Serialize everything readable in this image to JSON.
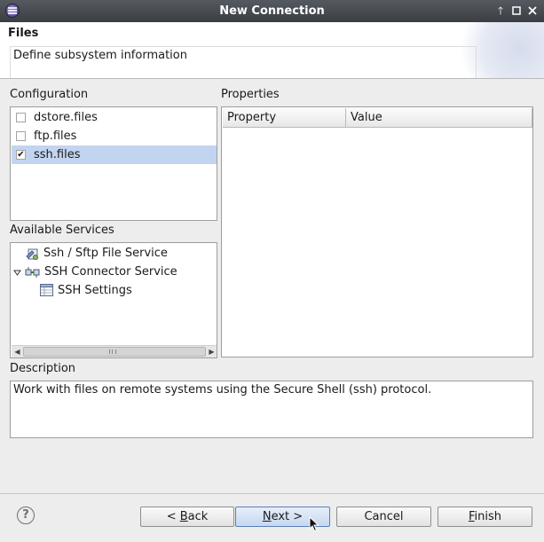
{
  "window": {
    "title": "New Connection"
  },
  "banner": {
    "heading": "Files",
    "description": "Define subsystem information"
  },
  "configuration": {
    "label": "Configuration",
    "items": [
      {
        "label": "dstore.files",
        "checked": false,
        "selected": false
      },
      {
        "label": "ftp.files",
        "checked": false,
        "selected": false
      },
      {
        "label": "ssh.files",
        "checked": true,
        "selected": true
      }
    ]
  },
  "properties": {
    "label": "Properties",
    "columns": [
      "Property",
      "Value"
    ]
  },
  "services": {
    "label": "Available Services",
    "items": [
      {
        "label": "Ssh / Sftp File Service",
        "icon": "file-service-icon"
      },
      {
        "label": "SSH Connector Service",
        "icon": "connector-icon",
        "expanded": true
      },
      {
        "label": "SSH Settings",
        "icon": "settings-table-icon"
      }
    ]
  },
  "description": {
    "label": "Description",
    "text": "Work with files on remote systems using the Secure Shell (ssh) protocol."
  },
  "buttons": {
    "back": {
      "mnemonic": "B",
      "rest": "ack",
      "prefix": "< "
    },
    "next": {
      "mnemonic": "N",
      "rest": "ext",
      "suffix": " >"
    },
    "cancel": "Cancel",
    "finish": {
      "mnemonic": "F",
      "rest": "inish"
    }
  },
  "help_label": "?"
}
